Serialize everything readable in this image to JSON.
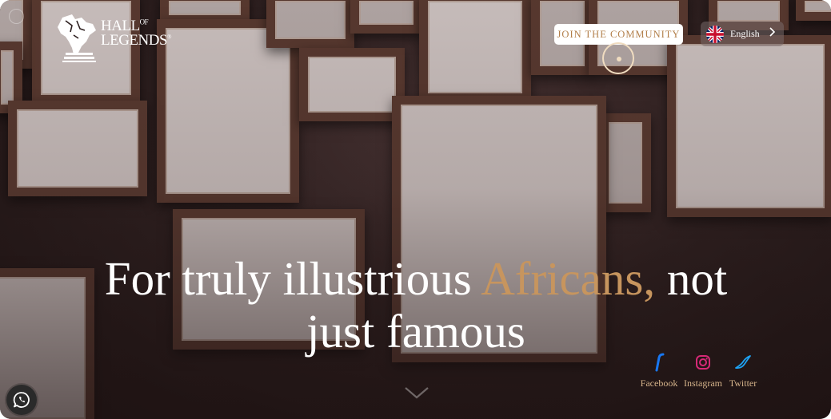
{
  "brand": {
    "line1": "HALL",
    "line1_small": "OF",
    "line2": "LEGENDS",
    "mark": "®"
  },
  "header": {
    "join_label": "JOIN THE COMMUNITY",
    "language": {
      "label": "English",
      "flag_icon": "uk-flag-icon",
      "chevron_icon": "chevron-right-icon"
    }
  },
  "hero": {
    "headline_before": "For truly illustrious ",
    "headline_accent": "Africans,",
    "headline_after": " not just famous",
    "scroll_icon": "chevron-down-icon"
  },
  "social": [
    {
      "label": "Facebook",
      "icon": "facebook-icon"
    },
    {
      "label": "Instagram",
      "icon": "instagram-icon"
    },
    {
      "label": "Twitter",
      "icon": "twitter-icon"
    }
  ],
  "widgets": {
    "whatsapp_icon": "whatsapp-icon"
  },
  "colors": {
    "accent": "#c7955e",
    "button_text": "#b27f4a",
    "social_text": "#d6b48b",
    "facebook": "#1877f2",
    "instagram": "#d62976",
    "twitter": "#1da1f2"
  }
}
